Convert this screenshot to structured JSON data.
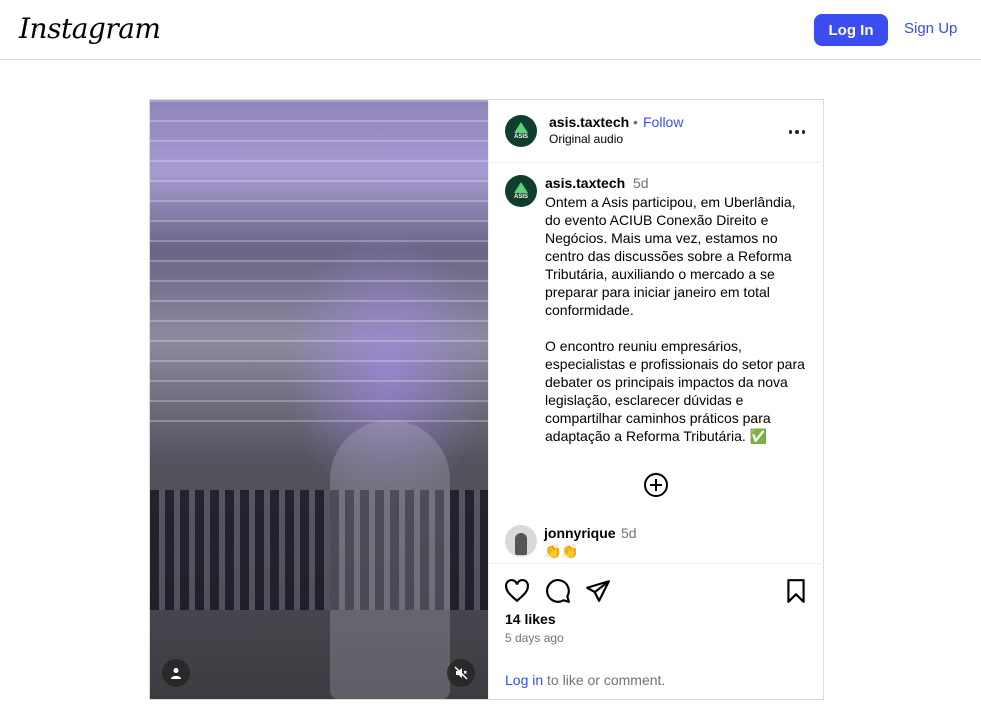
{
  "header": {
    "logo_text": "Instagram",
    "login_label": "Log In",
    "signup_label": "Sign Up"
  },
  "post": {
    "author": "asis.taxtech",
    "separator": "•",
    "follow_label": "Follow",
    "audio_label": "Original audio",
    "avatar_text": "ASIS",
    "caption": {
      "author": "asis.taxtech",
      "time": "5d",
      "text": "Ontem a Asis participou, em Uberlândia, do evento ACIUB Conexão Direito e Negócios. Mais uma vez, estamos no centro das discussões sobre a Reforma Tributária, auxiliando o mercado a se preparar para iniciar janeiro em total conformidade.\n\nO encontro reuniu empresários, especialistas e profissionais do setor para debater os principais impactos da nova legislação, esclarecer dúvidas e compartilhar caminhos práticos para adaptação a Reforma Tributária. ✅"
    },
    "comments": [
      {
        "author": "jonnyrique",
        "time": "5d",
        "text": "👏👏"
      }
    ],
    "likes": "14 likes",
    "posted_ago": "5 days ago",
    "login_prompt": {
      "link": "Log in",
      "rest": " to like or comment."
    }
  },
  "icons": {
    "more": "more-options-icon",
    "add": "add-circle-icon",
    "like": "heart-icon",
    "comment": "comment-icon",
    "share": "share-icon",
    "save": "bookmark-icon",
    "user": "user-tag-icon",
    "mute": "mute-icon"
  },
  "colors": {
    "brand_blue": "#3b4cf0",
    "asis_green": "#0f3d2e",
    "muted_text": "#737373"
  }
}
